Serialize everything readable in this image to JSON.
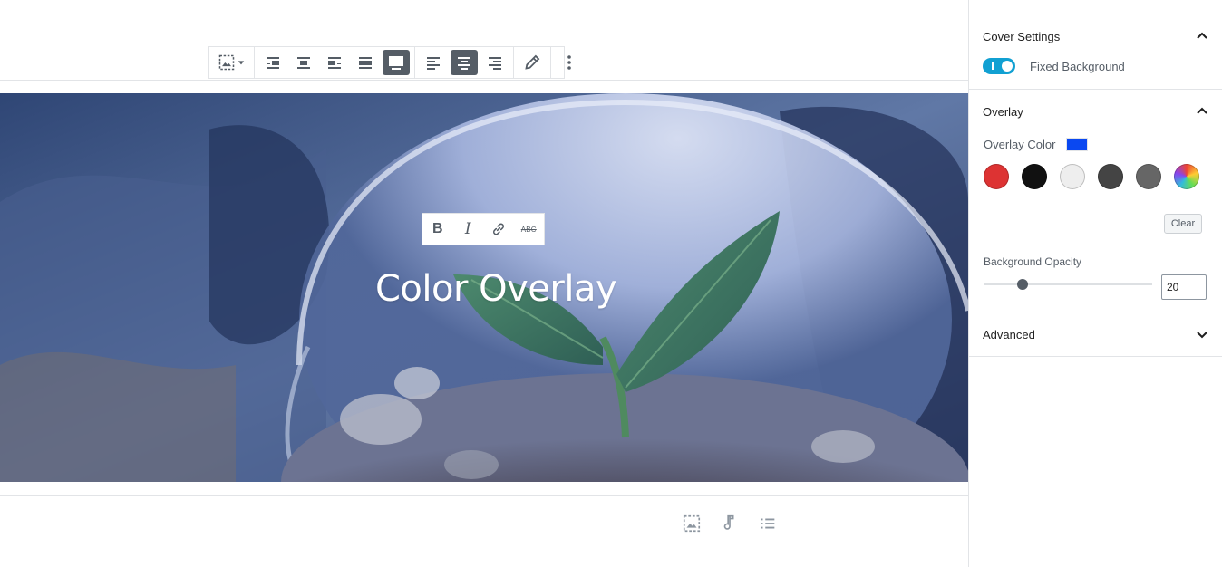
{
  "toolbar": {
    "groups": [
      [
        "change-block-type"
      ],
      [
        "align-left",
        "align-center",
        "align-right",
        "wide-width",
        "full-width"
      ],
      [
        "text-align-left",
        "text-align-center",
        "text-align-right"
      ],
      [
        "edit"
      ],
      [
        "more-options"
      ]
    ],
    "active": [
      "full-width",
      "text-align-center"
    ]
  },
  "cover": {
    "title": "Color Overlay",
    "format_toolbar": {
      "bold": "B",
      "italic": "I",
      "strikethrough": "ABC"
    }
  },
  "inserter": [
    "image-icon",
    "audio-icon",
    "list-icon"
  ],
  "sidebar": {
    "cover_settings": {
      "title": "Cover Settings",
      "fixed_background_label": "Fixed Background",
      "fixed_background_on": true
    },
    "overlay": {
      "title": "Overlay",
      "color_label": "Overlay Color",
      "current_color": "#0a48f1",
      "swatches": [
        "#dd3333",
        "#111111",
        "#eeeeee",
        "#444444",
        "#666666",
        "gradient"
      ],
      "clear_label": "Clear",
      "opacity_label": "Background Opacity",
      "opacity_value": "20"
    },
    "advanced": {
      "title": "Advanced"
    }
  }
}
